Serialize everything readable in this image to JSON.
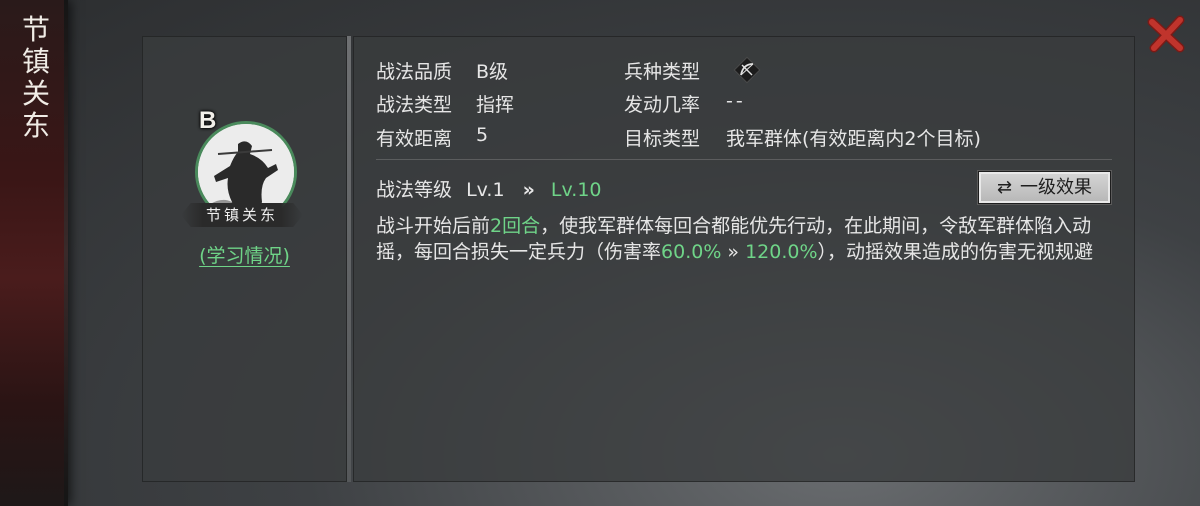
{
  "banner": {
    "title_chars": [
      "节",
      "镇",
      "关",
      "东"
    ]
  },
  "skill": {
    "grade_badge": "B",
    "name_plate": "节镇关东",
    "learn_link": "(学习情况)"
  },
  "stats": {
    "quality_label": "战法品质",
    "quality_value": "B级",
    "troop_label": "兵种类型",
    "troop_icon": "bow-icon",
    "type_label": "战法类型",
    "type_value": "指挥",
    "trigger_label": "发动几率",
    "trigger_value": "--",
    "range_label": "有效距离",
    "range_value": "5",
    "target_label": "目标类型",
    "target_value": "我军群体(有效距离内2个目标)"
  },
  "level": {
    "label": "战法等级",
    "current": "Lv.1",
    "arrow": "»",
    "max": "Lv.10",
    "effect_button": "一级效果"
  },
  "description": {
    "p1": "战斗开始后前",
    "rounds": "2回合",
    "p2": "，使我军群体每回合都能优先行动，在此期间，令敌军群体陷入动摇，每回合损失一定兵力（伤害率",
    "rate_from": "60.0%",
    "arrow": "»",
    "rate_to": "120.0%",
    "p3": "），动摇效果造成的伤害无视规避"
  },
  "colors": {
    "highlight": "#6fd488",
    "close": "#c0342c",
    "ring": "#4a8a5c"
  }
}
